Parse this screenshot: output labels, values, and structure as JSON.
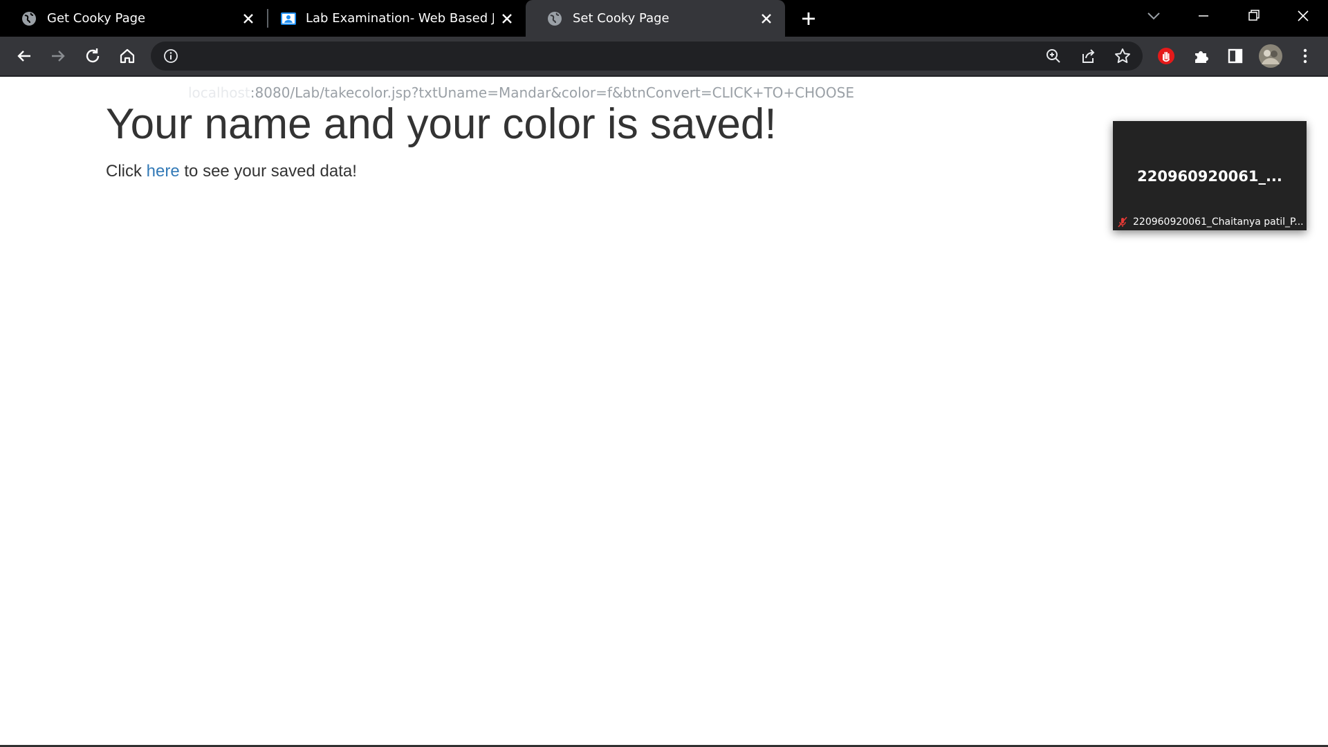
{
  "browser": {
    "tabs": [
      {
        "title": "Get Cooky Page",
        "favicon": "globe-icon"
      },
      {
        "title": "Lab Examination- Web Based Java",
        "favicon": "classroom-icon"
      },
      {
        "title": "Set Cooky Page",
        "favicon": "globe-icon",
        "active": true
      }
    ],
    "url_host": "localhost",
    "url_rest": ":8080/Lab/takecolor.jsp?txtUname=Mandar&color=f&btnConvert=CLICK+TO+CHOOSE"
  },
  "page": {
    "heading": "Your name and your color is saved!",
    "text_before": "Click ",
    "link_text": "here",
    "text_after": " to see your saved data!"
  },
  "meeting_tile": {
    "name": "220960920061_...",
    "label": "220960920061_Chaitanya patil_P..."
  },
  "colors": {
    "tab_bar": "#000000",
    "toolbar": "#35363a",
    "omnibox": "#202124",
    "link": "#337ab7",
    "text": "#333333",
    "adblock": "#e51a1a"
  }
}
